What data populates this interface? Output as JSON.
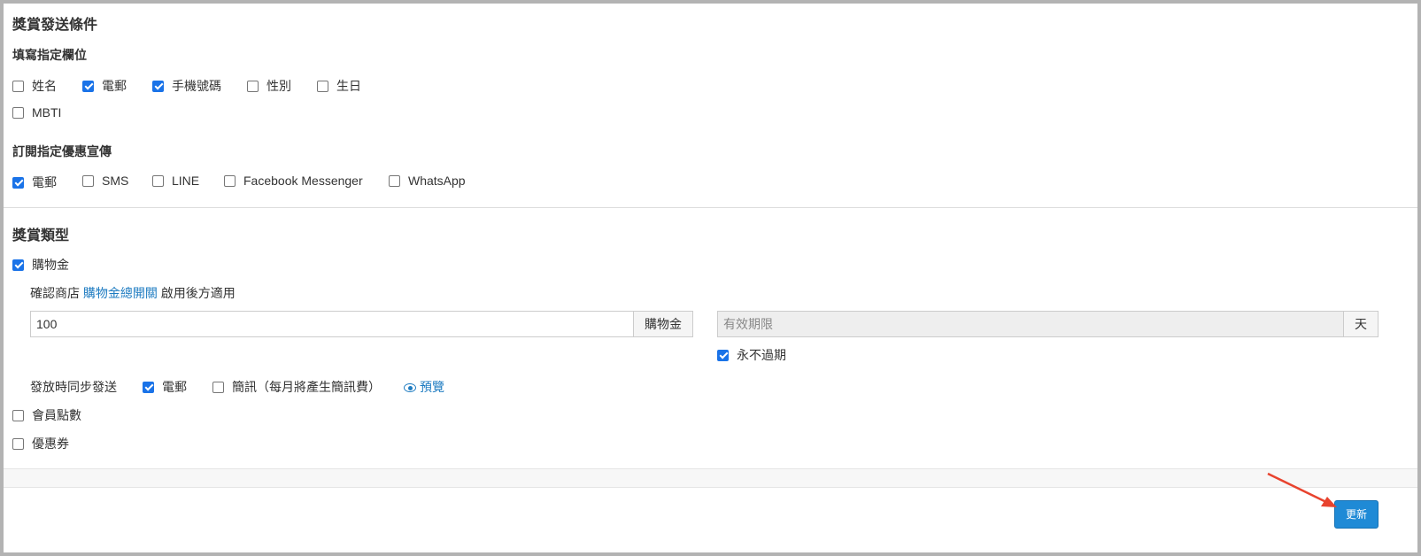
{
  "conditions": {
    "title": "獎賞發送條件",
    "fill_fields_title": "填寫指定欄位",
    "fields": [
      {
        "label": "姓名",
        "checked": false
      },
      {
        "label": "電郵",
        "checked": true
      },
      {
        "label": "手機號碼",
        "checked": true
      },
      {
        "label": "性別",
        "checked": false
      },
      {
        "label": "生日",
        "checked": false
      },
      {
        "label": "MBTI",
        "checked": false
      }
    ],
    "subscribe_title": "訂閱指定優惠宣傳",
    "channels": [
      {
        "label": "電郵",
        "checked": true
      },
      {
        "label": "SMS",
        "checked": false
      },
      {
        "label": "LINE",
        "checked": false
      },
      {
        "label": "Facebook Messenger",
        "checked": false
      },
      {
        "label": "WhatsApp",
        "checked": false
      }
    ]
  },
  "reward_type": {
    "title": "獎賞類型",
    "credit": {
      "label": "購物金",
      "checked": true,
      "note_prefix": "確認商店",
      "note_link": "購物金總開關",
      "note_suffix": "啟用後方適用",
      "amount_value": "100",
      "amount_addon": "購物金",
      "validity_placeholder": "有效期限",
      "validity_addon": "天",
      "never_expire_label": "永不過期",
      "never_expire_checked": true,
      "sync_label": "發放時同步發送",
      "sync_email_label": "電郵",
      "sync_email_checked": true,
      "sync_sms_label": "簡訊（每月將產生簡訊費）",
      "sync_sms_checked": false,
      "preview_label": "預覽",
      "preview_icon": "eye-icon"
    },
    "points": {
      "label": "會員點數",
      "checked": false
    },
    "coupon": {
      "label": "優惠券",
      "checked": false
    }
  },
  "footer": {
    "update_label": "更新",
    "accent": "#1f8ad6"
  }
}
